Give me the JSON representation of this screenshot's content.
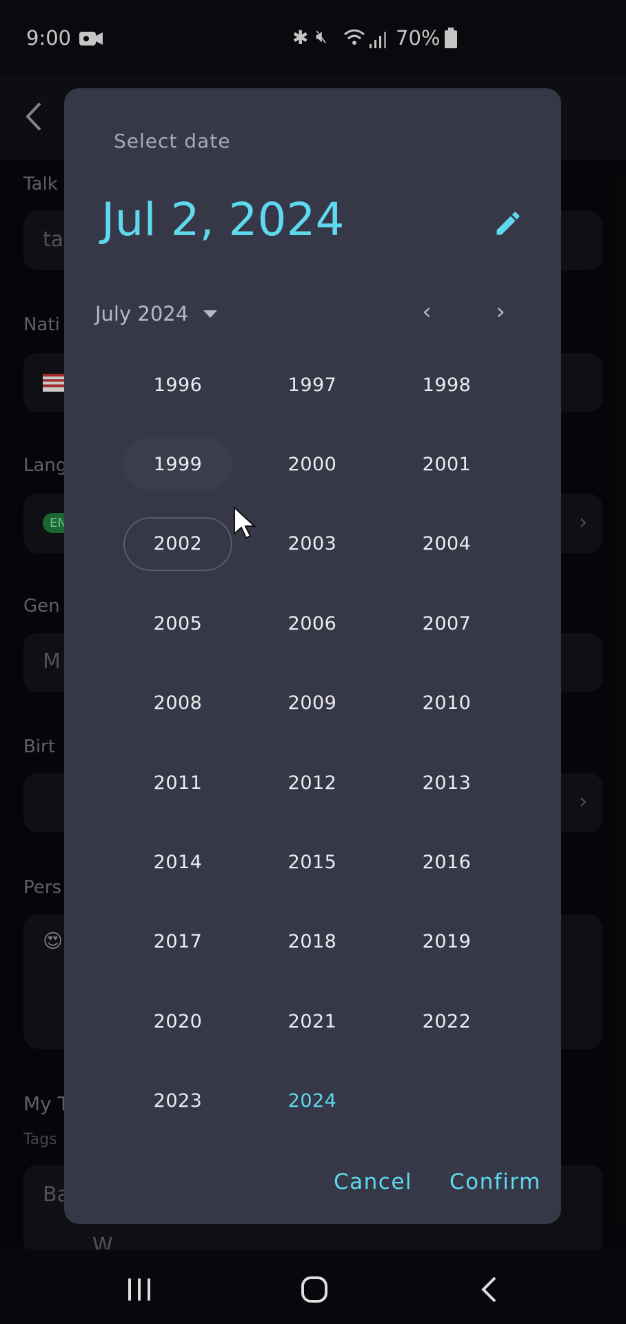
{
  "status_bar": {
    "time": "9:00",
    "battery": "70%",
    "icons": [
      "video-record-icon",
      "bluetooth-icon",
      "mute-icon",
      "wifi-icon",
      "signal-icon",
      "battery-icon"
    ]
  },
  "background": {
    "labels": [
      "Talk",
      "Nati",
      "Lang",
      "Gen",
      "Birt",
      "Pers",
      "My T",
      "Tags"
    ],
    "talk_value": "ta",
    "gender_value": "M",
    "language_badge": "EN",
    "tags_value": "Ba",
    "work_row": "W"
  },
  "dialog": {
    "title": "Select date",
    "selected_date": "Jul 2, 2024",
    "month_year": "July 2024",
    "years": [
      "1996",
      "1997",
      "1998",
      "1999",
      "2000",
      "2001",
      "2002",
      "2003",
      "2004",
      "2005",
      "2006",
      "2007",
      "2008",
      "2009",
      "2010",
      "2011",
      "2012",
      "2013",
      "2014",
      "2015",
      "2016",
      "2017",
      "2018",
      "2019",
      "2020",
      "2021",
      "2022",
      "2023",
      "2024"
    ],
    "current_year": "2024",
    "focused_year": "2002",
    "hover_year": "1999",
    "cancel": "Cancel",
    "confirm": "Confirm"
  },
  "colors": {
    "accent": "#5fd9ee",
    "dialog_bg": "#363848",
    "background": "#0b0c10"
  }
}
